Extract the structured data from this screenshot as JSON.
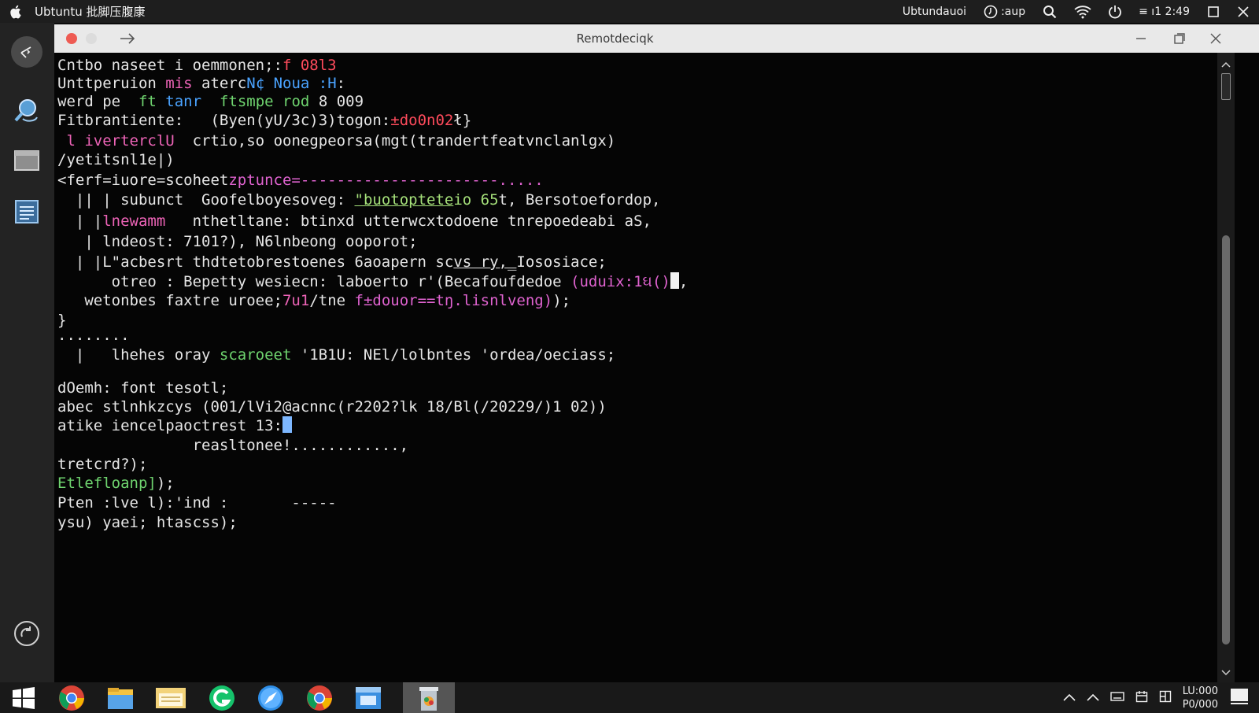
{
  "topbar": {
    "title": "Ubtuntu 批脚压腹康",
    "right_label": "Ubtundauoi",
    "status_label": ":aup",
    "battery_label": "≡ ı1 2:49"
  },
  "window": {
    "title": "Remotdeciqk"
  },
  "terminal": {
    "lines": [
      [
        {
          "t": "Cntbo naseet i oemmonen;:"
        },
        {
          "t": "f 08l3",
          "c": "c-red"
        }
      ],
      [
        {
          "t": "Unttperuion "
        },
        {
          "t": "mis",
          "c": "c-pink"
        },
        {
          "t": " aterc"
        },
        {
          "t": "N¢ Noua :",
          "c": "c-blue"
        },
        {
          "t": "H",
          "c": "c-blue"
        },
        {
          "t": ":"
        }
      ],
      [
        {
          "t": "werd pe  "
        },
        {
          "t": "ft",
          "c": "c-green"
        },
        {
          "t": " "
        },
        {
          "t": "tanr",
          "c": "c-blue"
        },
        {
          "t": "  "
        },
        {
          "t": "ftsmpe",
          "c": "c-green"
        },
        {
          "t": " "
        },
        {
          "t": "rod",
          "c": "c-green"
        },
        {
          "t": " 8 009"
        }
      ],
      [
        {
          "t": "Fitbrantiente:   (Byen(yU/3c)3)togon:"
        },
        {
          "t": "±do0n02",
          "c": "c-red"
        },
        {
          "t": "ł}"
        }
      ],
      [
        {
          "t": " "
        },
        {
          "t": "l iverterclU",
          "c": "c-pink"
        },
        {
          "t": "  crtio,so oonegpeorsa(mgt(trandertfeatvnclanlgx)"
        }
      ],
      [
        {
          "t": "/yetitsnl1e|)"
        }
      ],
      [
        {
          "t": "<ferf=iuore=scoheet"
        },
        {
          "t": "zptunce=----------------------.....",
          "c": "c-magenta"
        }
      ],
      [
        {
          "t": "  || | subunct  Goofelbo"
        },
        {
          "t": "yesoveg: "
        },
        {
          "t": "\"buotoptete",
          "c": "c-lime c-ul"
        },
        {
          "t": "io 65",
          "c": "c-lime"
        },
        {
          "t": "t, Bersotoefordop,"
        }
      ],
      [
        {
          "t": "  | |"
        },
        {
          "t": "lnewamm",
          "c": "c-pink"
        },
        {
          "t": "   nthetltane: btinxd utterwcxtodoene tnrepoedeabi aS,"
        }
      ],
      [
        {
          "t": "   | lndeost: 7101?), N6lnbeong ooporot;"
        }
      ],
      [
        {
          "t": "  | |L\"acbesrt thdtetobrestoenes 6aoapern sc"
        },
        {
          "t": "vs ry,_",
          "c": "c-ul"
        },
        {
          "t": "Iososiace;"
        }
      ],
      [
        {
          "t": "      otreo : Bepetty wesiecn: laboerto r'(Becafoufdedoe "
        },
        {
          "t": "(uduix:1ઘ()",
          "c": "c-magenta"
        },
        {
          "t": "CURSOR"
        },
        {
          "t": ","
        }
      ],
      [
        {
          "t": "   wetonbes faxtre uroee;"
        },
        {
          "t": "7u1",
          "c": "c-pink"
        },
        {
          "t": "/tne "
        },
        {
          "t": "f±douor==t",
          "c": "c-magenta"
        },
        {
          "t": "ŋ.lisnlveng)",
          "c": "c-magenta"
        },
        {
          "t": ");"
        }
      ],
      [
        {
          "t": "}"
        }
      ],
      [
        {
          "t": "........"
        }
      ],
      [
        {
          "t": "  |   lhehes oray "
        },
        {
          "t": "scaroeet",
          "c": "c-green"
        },
        {
          "t": " '1B1U: NEl/lolbntes 'ordea/oeciass;"
        }
      ],
      [
        {
          "t": ""
        }
      ],
      [
        {
          "t": "dOemh: font tesotl;"
        }
      ],
      [
        {
          "t": "abec stlnhkzcys (001/lVi2@acnnc(r2202?lk 18/Bl(/20229/)1 02))"
        }
      ],
      [
        {
          "t": "atike iencelpaoctrest 13:"
        },
        {
          "t": "CURSORB"
        }
      ],
      [
        {
          "t": "               reasltonee!............,"
        }
      ],
      [
        {
          "t": "tretcrd?);"
        }
      ],
      [
        {
          "t": "Etlefloanp]",
          "c": "c-green"
        },
        {
          "t": ");"
        }
      ],
      [
        {
          "t": "Pten :lve l):'ind :       -----"
        }
      ],
      [
        {
          "t": "ysu) yaei; htascss);"
        }
      ]
    ]
  },
  "tray": {
    "clock_time": "LU:000",
    "clock_date": "P0/000"
  },
  "colors": {
    "terminal_bg": "#050505",
    "titlebar_bg": "#e9e9e9",
    "dock_bg": "#232323",
    "taskbar_bg": "#191919",
    "accent_red": "#ff4b5c",
    "accent_pink": "#ec63b6",
    "accent_blue": "#4aa3ff",
    "accent_green": "#6fd46f"
  }
}
